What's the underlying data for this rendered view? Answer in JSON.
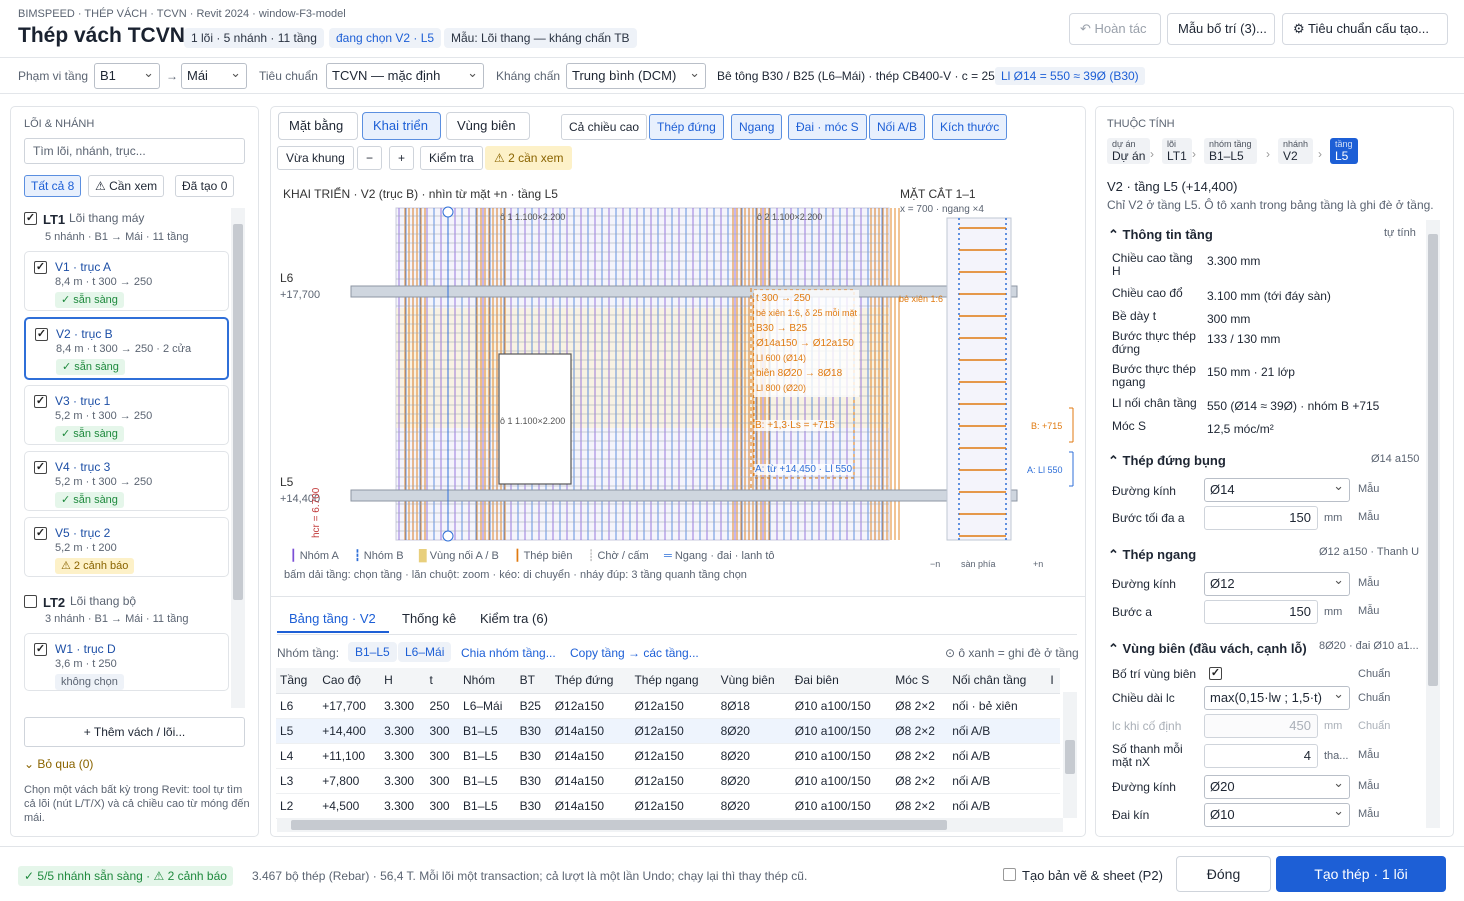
{
  "header": {
    "breadcrumb": "BIMSPEED · THÉP VÁCH · TCVN  ·  Revit 2024 · window-F3-model",
    "title": "Thép vách TCVN",
    "chips": [
      "1 lõi · 5 nhánh · 11 tầng",
      "đang chọn V2 · L5",
      "Mẫu: Lõi thang — kháng chấn TB"
    ],
    "undo": "Hoàn tác",
    "layout_btn": "Mẫu bố trí (3)...",
    "std_btn": "Tiêu chuẩn cấu tạo..."
  },
  "params": {
    "range_label": "Phạm vi tầng",
    "from": "B1",
    "arrow": "→",
    "to": "Mái",
    "std_label": "Tiêu chuẩn",
    "std": "TCVN — mặc định",
    "seismic_label": "Kháng chấn",
    "seismic": "Trung bình (DCM)",
    "concrete": "Bê tông B30 / B25 (L6–Mái) · thép CB400-V · c = 25",
    "lap": "Ll Ø14 = 550 ≈ 39Ø (B30)"
  },
  "left": {
    "section": "LÕI & NHÁNH",
    "search_placeholder": "Tìm lõi, nhánh, trục...",
    "filters": [
      "Tất cả 8",
      "Cần xem",
      "Đã tạo 0"
    ],
    "groups": [
      {
        "code": "LT1",
        "name": "Lõi thang máy",
        "meta": "5 nhánh · B1 → Mái · 11 tầng"
      },
      {
        "code": "LT2",
        "name": "Lõi thang bộ",
        "meta": "3 nhánh · B1 → Mái · 11 tầng"
      }
    ],
    "walls": [
      {
        "title": "V1 · trục A",
        "meta": "8,4 m · t 300 → 250",
        "status": "✓ sẵn sàng"
      },
      {
        "title": "V2 · trục B",
        "meta": "8,4 m · t 300 → 250 · 2 cửa",
        "status": "✓ sẵn sàng"
      },
      {
        "title": "V3 · trục 1",
        "meta": "5,2 m · t 300 → 250",
        "status": "✓ sẵn sàng"
      },
      {
        "title": "V4 · trục 3",
        "meta": "5,2 m · t 300 → 250",
        "status": "✓ sẵn sàng"
      },
      {
        "title": "V5 · trục 2",
        "meta": "5,2 m · t 200",
        "status": "2 cảnh báo"
      },
      {
        "title": "W1 · trục D",
        "meta": "3,6 m · t 250",
        "status": "không chọn"
      }
    ],
    "add_btn": "+ Thêm vách / lõi...",
    "skip": "Bỏ qua (0)",
    "hint": "Chọn một vách bất kỳ trong Revit: tool tự tìm cả lõi (nút L/T/X) và cả chiều cao từ móng đến mái."
  },
  "center": {
    "views": [
      "Mặt bằng",
      "Khai triển",
      "Vùng biên"
    ],
    "layers": [
      "Cả chiều cao",
      "Thép đứng",
      "Ngang",
      "Đai · móc S",
      "Nối A/B",
      "Kích thước"
    ],
    "tools": [
      "Vừa khung",
      "−",
      "+",
      "Kiểm tra",
      "2 cần xem"
    ],
    "elev_title": "KHAI TRIỂN · V2 (trục B) · nhìn từ mặt +n · tầng L5",
    "sec_title": "MẶT CẮT 1–1",
    "sec_sub": "x = 700 · ngang ×4",
    "levels": [
      {
        "name": "L6",
        "elev": "+17,700"
      },
      {
        "name": "L5",
        "elev": "+14,400"
      }
    ],
    "hcr": "hcr = 6.700",
    "openings": [
      "ô 1 1.100×2.200",
      "ô 2 1.100×2.200",
      "ô 1 1.100×2.200"
    ],
    "callouts": [
      "t 300 → 250",
      "bẻ xiên 1:6, δ 25 mỗi mặt",
      "B30 → B25",
      "Ø14a150 → Ø12a150",
      "Ll 600 (Ø14)",
      "biên 8Ø20 → 8Ø18",
      "Ll 800 (Ø20)",
      "B: +1,3·Ls = +715",
      "A: từ +14,450 · Ll 550"
    ],
    "sec_notes": [
      "bẻ xiên 1:6",
      "B: +715",
      "A: Ll 550",
      "−n",
      "sàn phía",
      "+n"
    ],
    "legend": [
      "Nhóm A",
      "Nhóm B",
      "Vùng nối A / B",
      "Thép biên",
      "Chờ / cấm",
      "Ngang · đai · lanh tô"
    ],
    "hint": "bấm dải tầng: chọn tầng · lăn chuột: zoom · kéo: di chuyển · nháy đúp: 3 tầng quanh tầng chọn"
  },
  "bottom": {
    "tabs": [
      "Bảng tầng · V2",
      "Thống kê",
      "Kiểm tra (6)"
    ],
    "group_label": "Nhóm tầng:",
    "groups": [
      "B1–L5",
      "L6–Mái"
    ],
    "links": [
      "Chia nhóm tầng...",
      "Copy tầng → các tầng..."
    ],
    "note": "ô xanh = ghi đè ở tầng",
    "columns": [
      "Tầng",
      "Cao độ",
      "H",
      "t",
      "Nhóm",
      "BT",
      "Thép đứng",
      "Thép ngang",
      "Vùng biên",
      "Đai biên",
      "Móc S",
      "Nối chân tầng",
      "I"
    ],
    "rows": [
      [
        "L6",
        "+17,700",
        "3.300",
        "250",
        "L6–Mái",
        "B25",
        "Ø12a150",
        "Ø12a150",
        "8Ø18",
        "Ø10 a100/150",
        "Ø8 2×2",
        "nối · bẻ xiên"
      ],
      [
        "L5",
        "+14,400",
        "3.300",
        "300",
        "B1–L5",
        "B30",
        "Ø14a150",
        "Ø12a150",
        "8Ø20",
        "Ø10 a100/150",
        "Ø8 2×2",
        "nối A/B"
      ],
      [
        "L4",
        "+11,100",
        "3.300",
        "300",
        "B1–L5",
        "B30",
        "Ø14a150",
        "Ø12a150",
        "8Ø20",
        "Ø10 a100/150",
        "Ø8 2×2",
        "nối A/B"
      ],
      [
        "L3",
        "+7,800",
        "3.300",
        "300",
        "B1–L5",
        "B30",
        "Ø14a150",
        "Ø12a150",
        "8Ø20",
        "Ø10 a100/150",
        "Ø8 2×2",
        "nối A/B"
      ],
      [
        "L2",
        "+4,500",
        "3.300",
        "300",
        "B1–L5",
        "B30",
        "Ø14a150",
        "Ø12a150",
        "8Ø20",
        "Ø10 a100/150",
        "Ø8 2×2",
        "nối A/B"
      ]
    ]
  },
  "props": {
    "section": "THUỘC TÍNH",
    "crumbs": [
      [
        "dự án",
        "Dự án"
      ],
      [
        "lõi",
        "LT1"
      ],
      [
        "nhóm tầng",
        "B1–L5"
      ],
      [
        "nhánh",
        "V2"
      ],
      [
        "tầng",
        "L5"
      ]
    ],
    "title": "V2 · tầng L5 (+14,400)",
    "sub": "Chỉ V2 ở tầng L5. Ô tô xanh trong bảng tầng là ghi đè ở tầng.",
    "s1": "Thông tin tầng",
    "s1r": "tự tính",
    "info": [
      [
        "Chiều cao tầng H",
        "3.300 mm"
      ],
      [
        "Chiều cao đổ",
        "3.100 mm (tới đáy sàn)"
      ],
      [
        "Bề dày t",
        "300 mm"
      ],
      [
        "Bước thực thép đứng",
        "133 / 130 mm"
      ],
      [
        "Bước thực thép ngang",
        "150 mm · 21 lớp"
      ],
      [
        "Ll nối chân tầng",
        "550 (Ø14 ≈ 39Ø) · nhóm B +715"
      ],
      [
        "Móc S",
        "12,5 móc/m²"
      ]
    ],
    "s2": "Thép đứng bụng",
    "s2r": "Ø14 a150",
    "s2_dia_label": "Đường kính",
    "s2_dia": "Ø14",
    "s2_max_label": "Bước tối đa a",
    "s2_max": "150",
    "s3": "Thép ngang",
    "s3r": "Ø12 a150 · Thanh U",
    "s3_dia_label": "Đường kính",
    "s3_dia": "Ø12",
    "s3_step_label": "Bước a",
    "s3_step": "150",
    "s4": "Vùng biên (đầu vách, cạnh lỗ)",
    "s4r": "8Ø20 · đai Ø10 a1...",
    "s4_en_label": "Bố trí vùng biên",
    "s4_len_label": "Chiều dài lc",
    "s4_len": "max(0,15·lw ; 1,5·t)",
    "s4_fix_label": "lc khi cố định",
    "s4_fix": "450",
    "s4_n_label": "Số thanh mỗi mặt nX",
    "s4_n": "4",
    "s4_n_unit": "tha...",
    "s4_dia_label": "Đường kính",
    "s4_dia": "Ø20",
    "s4_hoop_label": "Đai kín",
    "s4_hoop": "Ø10",
    "unit": "mm",
    "mau": "Mẫu",
    "chuan": "Chuẩn"
  },
  "footer": {
    "status": "✓ 5/5 nhánh sẵn sàng · ⚠ 2 cảnh báo",
    "summary": "3.467 bộ thép (Rebar) · 56,4 T. Mỗi lõi một transaction; cả lượt là một lần Undo; chạy lại thì thay thép cũ.",
    "sheet": "Tạo bản vẽ & sheet (P2)",
    "close": "Đóng",
    "create": "Tạo thép · 1 lõi"
  },
  "colors": {
    "accent": "#1d5fd6",
    "groupA": "#7b4fd6",
    "groupB": "#2f6fd8",
    "lap": "#f2d98a",
    "boundary": "#e07a10"
  }
}
